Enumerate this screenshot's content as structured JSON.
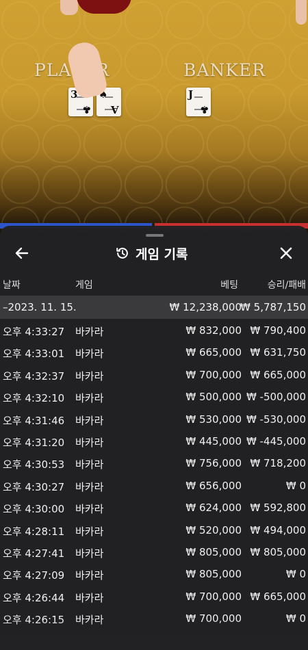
{
  "scene": {
    "player_label": "PLAYER",
    "banker_label": "BANKER",
    "cards": [
      {
        "rank": "3",
        "suit": "♣"
      },
      {
        "rank": "A",
        "suit": "♠"
      },
      {
        "rank": "J",
        "suit": "♣"
      }
    ]
  },
  "panel": {
    "title": "게임 기록",
    "columns": {
      "date": "날짜",
      "game": "게임",
      "bet": "베팅",
      "win_loss": "승리/패배"
    },
    "summary": {
      "date": "–2023. 11. 15.",
      "bet": "₩ 12,238,000",
      "win_loss": "₩ 5,787,150"
    },
    "rows": [
      {
        "time": "오후 4:33:27",
        "game": "바카라",
        "bet": "₩ 832,000",
        "win": "₩ 790,400"
      },
      {
        "time": "오후 4:33:01",
        "game": "바카라",
        "bet": "₩ 665,000",
        "win": "₩ 631,750"
      },
      {
        "time": "오후 4:32:37",
        "game": "바카라",
        "bet": "₩ 700,000",
        "win": "₩ 665,000"
      },
      {
        "time": "오후 4:32:10",
        "game": "바카라",
        "bet": "₩ 500,000",
        "win": "₩ -500,000"
      },
      {
        "time": "오후 4:31:46",
        "game": "바카라",
        "bet": "₩ 530,000",
        "win": "₩ -530,000"
      },
      {
        "time": "오후 4:31:20",
        "game": "바카라",
        "bet": "₩ 445,000",
        "win": "₩ -445,000"
      },
      {
        "time": "오후 4:30:53",
        "game": "바카라",
        "bet": "₩ 756,000",
        "win": "₩ 718,200"
      },
      {
        "time": "오후 4:30:27",
        "game": "바카라",
        "bet": "₩ 656,000",
        "win": "₩ 0"
      },
      {
        "time": "오후 4:30:00",
        "game": "바카라",
        "bet": "₩ 624,000",
        "win": "₩ 592,800"
      },
      {
        "time": "오후 4:28:11",
        "game": "바카라",
        "bet": "₩ 520,000",
        "win": "₩ 494,000"
      },
      {
        "time": "오후 4:27:41",
        "game": "바카라",
        "bet": "₩ 805,000",
        "win": "₩ 805,000"
      },
      {
        "time": "오후 4:27:09",
        "game": "바카라",
        "bet": "₩ 805,000",
        "win": "₩ 0"
      },
      {
        "time": "오후 4:26:44",
        "game": "바카라",
        "bet": "₩ 700,000",
        "win": "₩ 665,000"
      },
      {
        "time": "오후 4:26:15",
        "game": "바카라",
        "bet": "₩ 700,000",
        "win": "₩ 0"
      }
    ]
  },
  "icons": {
    "back": "arrow-left-icon",
    "history": "history-clock-icon",
    "close": "close-icon"
  },
  "colors": {
    "table_felt": "#cfa032",
    "panel_bg": "#222224",
    "summary_bg": "#3a3a3c",
    "player_blue": "#2b55c8",
    "banker_red": "#c83030"
  }
}
